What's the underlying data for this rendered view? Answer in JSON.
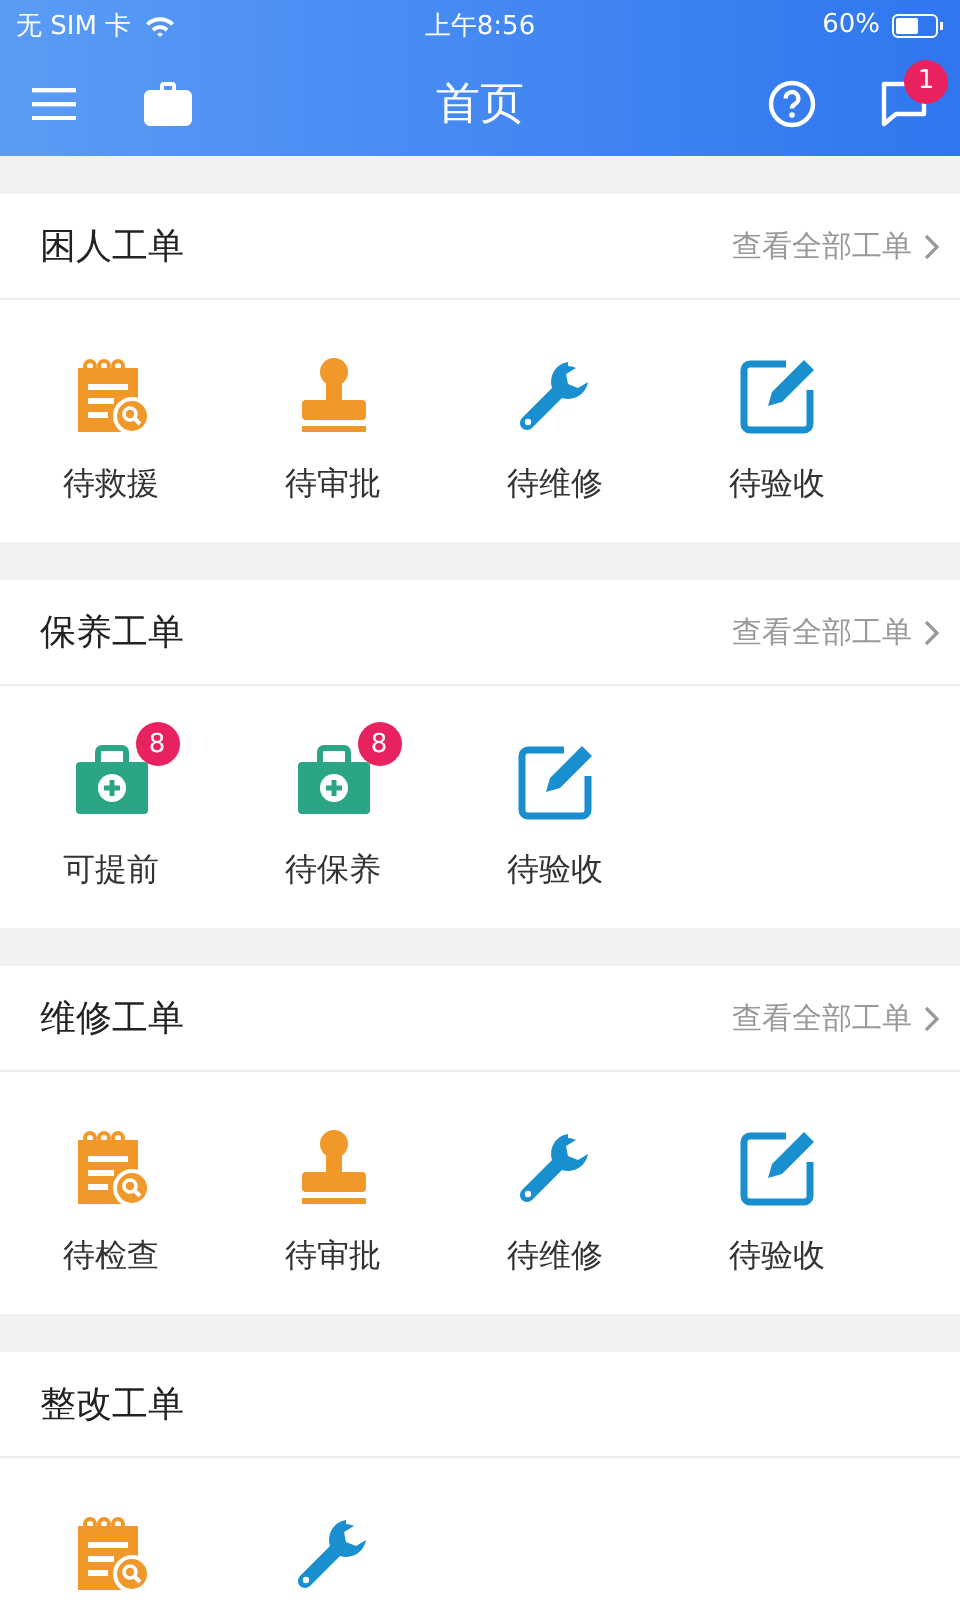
{
  "status_bar": {
    "carrier": "无 SIM 卡",
    "time": "上午8:56",
    "battery": {
      "text": "60%"
    }
  },
  "nav": {
    "title": "首页",
    "message_badge": "1"
  },
  "sections": [
    {
      "title": "困人工单",
      "more_link": "查看全部工单",
      "items": [
        {
          "kind": "notepad",
          "label": "待救援"
        },
        {
          "kind": "stamp",
          "label": "待审批"
        },
        {
          "kind": "wrench",
          "label": "待维修"
        },
        {
          "kind": "edit",
          "label": "待验收"
        }
      ]
    },
    {
      "title": "保养工单",
      "more_link": "查看全部工单",
      "items": [
        {
          "kind": "medkit",
          "label": "可提前",
          "badge": "8"
        },
        {
          "kind": "medkit",
          "label": "待保养",
          "badge": "8"
        },
        {
          "kind": "edit",
          "label": "待验收"
        }
      ]
    },
    {
      "title": "维修工单",
      "more_link": "查看全部工单",
      "items": [
        {
          "kind": "notepad",
          "label": "待检查"
        },
        {
          "kind": "stamp",
          "label": "待审批"
        },
        {
          "kind": "wrench",
          "label": "待维修"
        },
        {
          "kind": "edit",
          "label": "待验收"
        }
      ]
    },
    {
      "title": "整改工单",
      "items": [
        {
          "kind": "notepad"
        },
        {
          "kind": "wrench"
        }
      ]
    }
  ]
}
